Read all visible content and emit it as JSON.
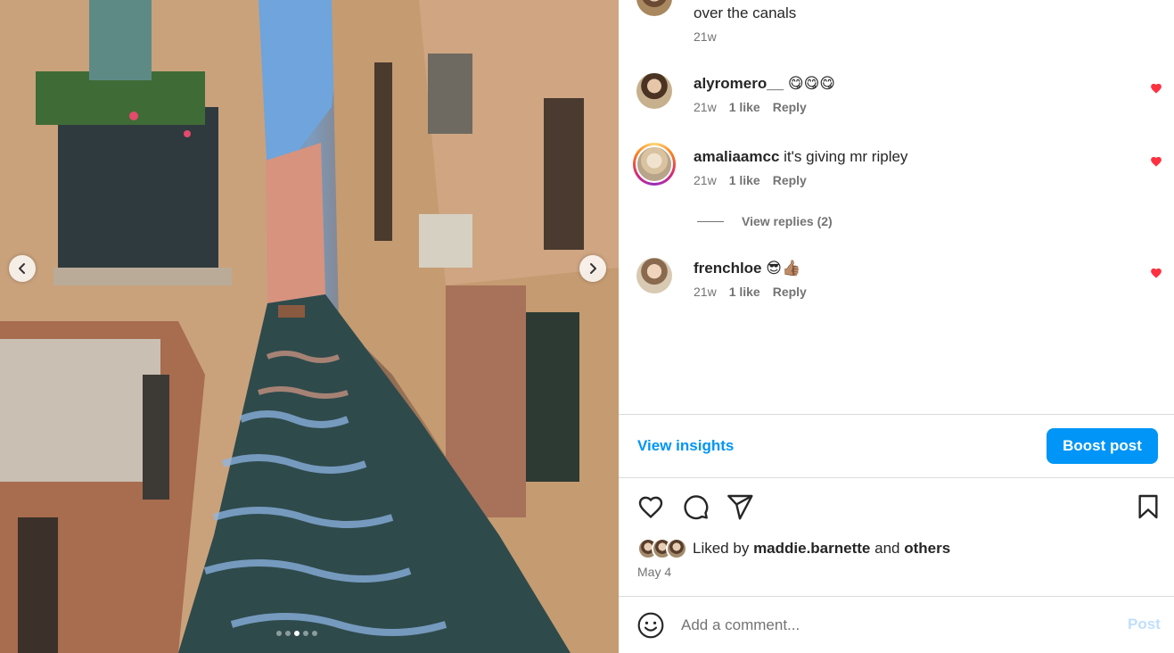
{
  "carousel": {
    "prev_icon": "chevron-left-icon",
    "next_icon": "chevron-right-icon",
    "slide_count": 5,
    "active_slide": 3
  },
  "caption_tail": {
    "text": "over the canals",
    "time": "21w"
  },
  "comments": [
    {
      "username": "alyromero__",
      "text": "😋😋😋",
      "time": "21w",
      "likes": "1 like",
      "reply": "Reply",
      "liked": true
    },
    {
      "username": "amaliaamcc",
      "text": "it's giving mr ripley",
      "time": "21w",
      "likes": "1 like",
      "reply": "Reply",
      "liked": true
    },
    {
      "username": "frenchloe",
      "text": "😎👍🏽",
      "time": "21w",
      "likes": "1 like",
      "reply": "Reply",
      "liked": true
    }
  ],
  "view_replies": "View replies (2)",
  "view_insights": "View insights",
  "boost_post": "Boost post",
  "likes": {
    "prefix": "Liked by",
    "user": "maddie.barnette",
    "and": "and",
    "others": "others"
  },
  "date": "May 4",
  "add_comment": {
    "placeholder": "Add a comment...",
    "post_label": "Post"
  },
  "colors": {
    "accent": "#0095f6",
    "heart": "#ff3040",
    "secondary_text": "#737373"
  }
}
